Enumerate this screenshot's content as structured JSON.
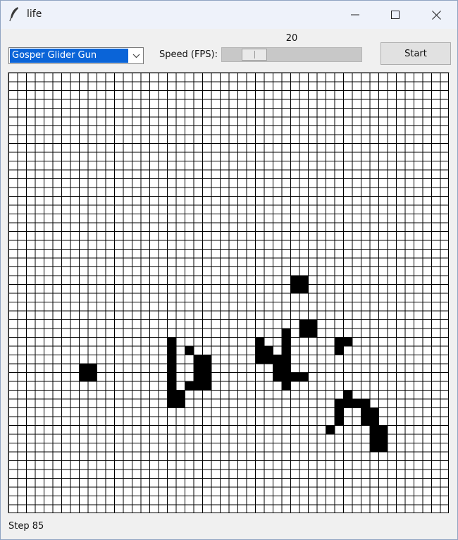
{
  "window": {
    "title": "life",
    "icon": "feather-icon",
    "controls": [
      "minimize-icon",
      "maximize-icon",
      "close-icon"
    ]
  },
  "toolbar": {
    "preset": {
      "selected": "Gosper Glider Gun",
      "icon": "chevron-down-icon"
    },
    "speed": {
      "label": "Speed (FPS):",
      "value": "20",
      "fraction": 0.17
    },
    "start_label": "Start"
  },
  "grid": {
    "cols": 50,
    "rows": 50,
    "line_color": "#000000",
    "live_color": "#000000",
    "dead_color": "#ffffff",
    "live_cells": [
      [
        33,
        8
      ],
      [
        33,
        9
      ],
      [
        34,
        8
      ],
      [
        34,
        9
      ],
      [
        30,
        18
      ],
      [
        31,
        18
      ],
      [
        32,
        18
      ],
      [
        33,
        18
      ],
      [
        34,
        18
      ],
      [
        35,
        18
      ],
      [
        31,
        20
      ],
      [
        35,
        20
      ],
      [
        32,
        21
      ],
      [
        33,
        21
      ],
      [
        34,
        21
      ],
      [
        35,
        21
      ],
      [
        32,
        22
      ],
      [
        33,
        22
      ],
      [
        34,
        22
      ],
      [
        35,
        22
      ],
      [
        36,
        18
      ],
      [
        37,
        18
      ],
      [
        36,
        19
      ],
      [
        37,
        19
      ],
      [
        30,
        28
      ],
      [
        31,
        28
      ],
      [
        32,
        28
      ],
      [
        32,
        29
      ],
      [
        31,
        29
      ],
      [
        32,
        30
      ],
      [
        33,
        30
      ],
      [
        34,
        30
      ],
      [
        29,
        31
      ],
      [
        30,
        31
      ],
      [
        31,
        31
      ],
      [
        32,
        31
      ],
      [
        33,
        31
      ],
      [
        34,
        31
      ],
      [
        35,
        31
      ],
      [
        34,
        32
      ],
      [
        34,
        33
      ],
      [
        23,
        32
      ],
      [
        24,
        32
      ],
      [
        23,
        33
      ],
      [
        24,
        33
      ],
      [
        28,
        33
      ],
      [
        29,
        33
      ],
      [
        28,
        34
      ],
      [
        29,
        34
      ],
      [
        30,
        37
      ],
      [
        30,
        38
      ],
      [
        31,
        37
      ],
      [
        36,
        38
      ],
      [
        37,
        37
      ],
      [
        37,
        38
      ],
      [
        37,
        39
      ],
      [
        38,
        37
      ],
      [
        39,
        37
      ],
      [
        40,
        36
      ],
      [
        37,
        40
      ],
      [
        38,
        40
      ],
      [
        39,
        40
      ],
      [
        39,
        41
      ],
      [
        40,
        41
      ],
      [
        40,
        42
      ],
      [
        41,
        41
      ],
      [
        38,
        41
      ],
      [
        41,
        42
      ],
      [
        42,
        42
      ],
      [
        42,
        41
      ]
    ]
  },
  "status": {
    "text": "Step 85"
  }
}
